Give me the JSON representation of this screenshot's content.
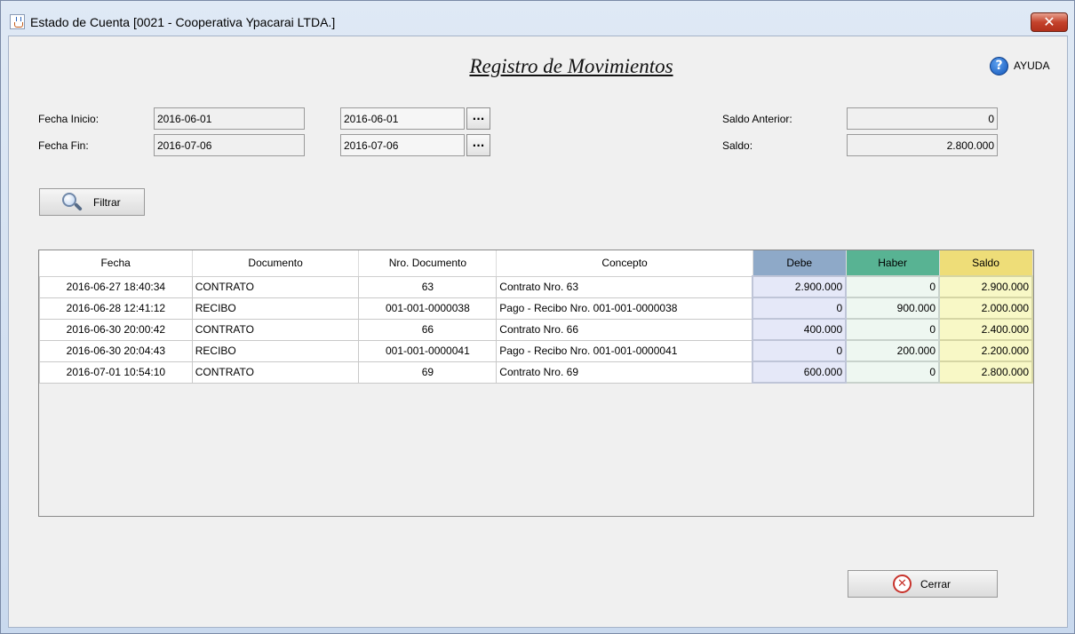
{
  "window": {
    "title": "Estado de Cuenta [0021 - Cooperativa Ypacarai LTDA.]",
    "close_symbol": "✕"
  },
  "header": {
    "title": "Registro de Movimientos",
    "help_label": "AYUDA",
    "help_symbol": "?"
  },
  "filters": {
    "fecha_inicio_label": "Fecha Inicio:",
    "fecha_inicio_value": "2016-06-01",
    "fecha_inicio_picker_value": "2016-06-01",
    "fecha_fin_label": "Fecha Fin:",
    "fecha_fin_value": "2016-07-06",
    "fecha_fin_picker_value": "2016-07-06",
    "picker_button_label": "...",
    "saldo_anterior_label": "Saldo Anterior:",
    "saldo_anterior_value": "0",
    "saldo_label": "Saldo:",
    "saldo_value": "2.800.000",
    "filter_button_label": "Filtrar"
  },
  "table": {
    "columns": [
      "Fecha",
      "Documento",
      "Nro. Documento",
      "Concepto",
      "Debe",
      "Haber",
      "Saldo"
    ],
    "rows": [
      [
        "2016-06-27 18:40:34",
        "CONTRATO",
        "63",
        "Contrato Nro. 63",
        "2.900.000",
        "0",
        "2.900.000"
      ],
      [
        "2016-06-28 12:41:12",
        "RECIBO",
        "001-001-0000038",
        "Pago - Recibo Nro. 001-001-0000038",
        "0",
        "900.000",
        "2.000.000"
      ],
      [
        "2016-06-30 20:00:42",
        "CONTRATO",
        "66",
        "Contrato Nro. 66",
        "400.000",
        "0",
        "2.400.000"
      ],
      [
        "2016-06-30 20:04:43",
        "RECIBO",
        "001-001-0000041",
        "Pago - Recibo Nro. 001-001-0000041",
        "0",
        "200.000",
        "2.200.000"
      ],
      [
        "2016-07-01 10:54:10",
        "CONTRATO",
        "69",
        "Contrato Nro. 69",
        "600.000",
        "0",
        "2.800.000"
      ]
    ]
  },
  "footer": {
    "close_button_label": "Cerrar",
    "close_icon_symbol": "✕"
  },
  "colors": {
    "debe_header": "#8ea9c8",
    "haber_header": "#58b393",
    "saldo_header": "#eedd78"
  }
}
